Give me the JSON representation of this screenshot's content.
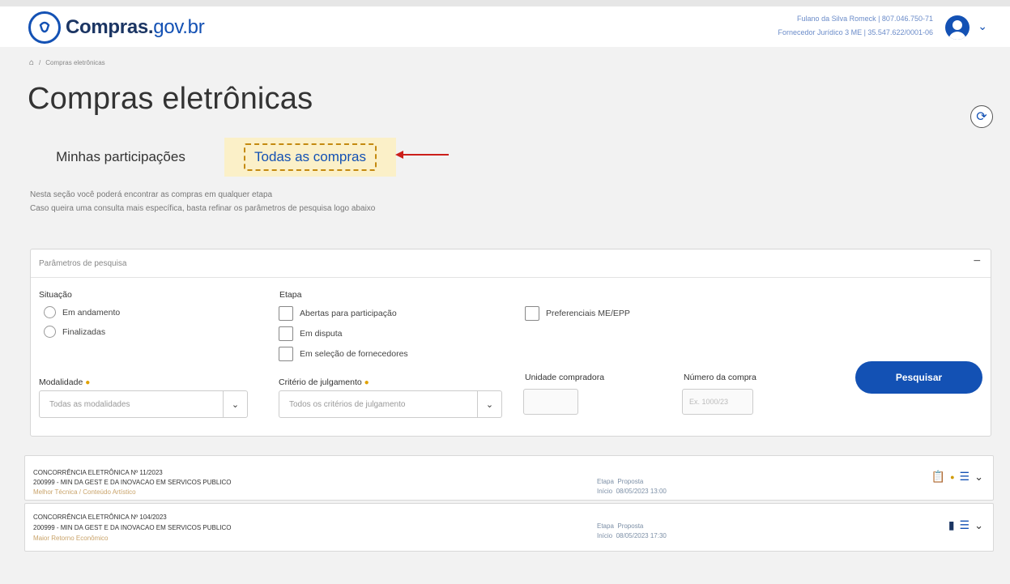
{
  "header": {
    "logo_main": "Compras.",
    "logo_domain": "gov.br",
    "user_line1": "Fulano da Silva Romeck | 807.046.750-71",
    "user_line2": "Fornecedor Jurídico 3 ME | 35.547.622/0001-06",
    "user_chevron": "⌄"
  },
  "breadcrumb": {
    "home_icon": "home-icon",
    "current": "Compras eletrônicas",
    "separator": "/"
  },
  "page": {
    "title": "Compras eletrônicas",
    "refresh_icon": "⟳"
  },
  "tabs": [
    {
      "label": "Minhas participações"
    },
    {
      "label": "Todas as compras"
    }
  ],
  "description": {
    "line1": "Nesta seção você poderá encontrar as compras em qualquer etapa",
    "line2": "Caso queira uma consulta mais específica, basta refinar os parâmetros de pesquisa logo abaixo"
  },
  "search_panel": {
    "title": "Parâmetros de pesquisa",
    "collapse": "−",
    "situacao_label": "Situação",
    "situacao_options": [
      "Em andamento",
      "Finalizadas"
    ],
    "etapa_label": "Etapa",
    "etapa_options": [
      "Abertas para participação",
      "Em disputa",
      "Em seleção de fornecedores"
    ],
    "preferenciais_label": "Preferenciais ME/EPP",
    "modalidade_label": "Modalidade",
    "modalidade_placeholder": "Todas as modalidades",
    "criterio_label": "Critério de julgamento",
    "criterio_placeholder": "Todos os critérios de julgamento",
    "unidade_label": "Unidade compradora",
    "numero_label": "Número da compra",
    "numero_placeholder": "Ex. 1000/23",
    "required_mark": "●",
    "search_button": "Pesquisar",
    "caret": "⌄"
  },
  "results": [
    {
      "title": "CONCORRÊNCIA ELETRÔNICA Nº 11/2023",
      "org": "200999 - MIN DA GEST E DA INOVACAO EM SERVICOS PUBLICO",
      "criterion": "Melhor Técnica / Conteúdo Artístico",
      "etapa_label": "Etapa",
      "etapa_value": "Proposta",
      "inicio_label": "Início",
      "inicio_value": "08/05/2023 13:00"
    },
    {
      "title": "CONCORRÊNCIA ELETRÔNICA Nº 104/2023",
      "org": "200999 - MIN DA GEST E DA INOVACAO EM SERVICOS PUBLICO",
      "criterion": "Maior Retorno Econômico",
      "etapa_label": "Etapa",
      "etapa_value": "Proposta",
      "inicio_label": "Início",
      "inicio_value": "08/05/2023 17:30"
    }
  ],
  "icons": {
    "list_icon": "☰",
    "expand_icon": "⌄",
    "doc_icon": "📋",
    "clip_icon": "▮"
  },
  "colors": {
    "brand_blue": "#1351b4",
    "tab_highlight": "#fbf0c8",
    "annotation_red": "#cc1f1a",
    "dash_outline": "#c48a10"
  }
}
